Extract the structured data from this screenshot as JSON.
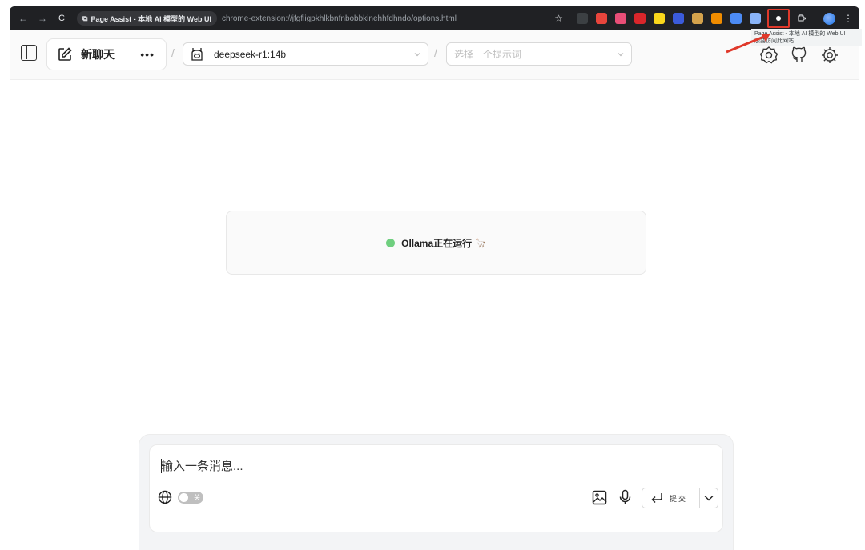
{
  "browser": {
    "tab_title": "Page Assist - 本地 AI 模型的 Web UI",
    "url": "chrome-extension://jfgfiigpkhlkbnfnbobbkinehhfdhndo/options.html",
    "back": "←",
    "forward": "→",
    "reload": "C",
    "star": "☆",
    "menu": "⋮",
    "extensions_icon": "puzzle-icon",
    "extensions": [
      {
        "name": "hi-ext-icon",
        "color": "#3c4043"
      },
      {
        "name": "red-ext-icon",
        "color": "#e8453c"
      },
      {
        "name": "pink-ext-icon",
        "color": "#e94e77"
      },
      {
        "name": "abp-ext-icon",
        "color": "#d9262b"
      },
      {
        "name": "moon-ext-icon",
        "color": "#f9d71c"
      },
      {
        "name": "diamond-ext-icon",
        "color": "#3b5bdb"
      },
      {
        "name": "cookie-ext-icon",
        "color": "#d4a24c"
      },
      {
        "name": "flame-ext-icon",
        "color": "#f08c00"
      },
      {
        "name": "window-ext-icon",
        "color": "#4c8bf5"
      },
      {
        "name": "translate-ext-icon",
        "color": "#8ab4f8"
      }
    ]
  },
  "tooltip": {
    "line1": "Page Assist - 本地 AI 模型的 Web UI",
    "line2": "想要访问此网站"
  },
  "header": {
    "new_chat_label": "新聊天",
    "more_label": "•••",
    "separator": "/",
    "model": "deepseek-r1:14b",
    "prompt_placeholder": "选择一个提示词",
    "right_icons": [
      "ollama-settings-icon",
      "github-icon",
      "settings-gear-icon"
    ]
  },
  "status": {
    "text": "Ollama正在运行",
    "emoji": "🦙",
    "dot_color": "#6fcf7f"
  },
  "composer": {
    "placeholder": "输入一条消息...",
    "toggle_label": "关",
    "submit_label": "提交"
  },
  "colors": {
    "chrome_bg": "#202124",
    "highlight": "#e0392b",
    "accent_green": "#6fcf7f"
  }
}
